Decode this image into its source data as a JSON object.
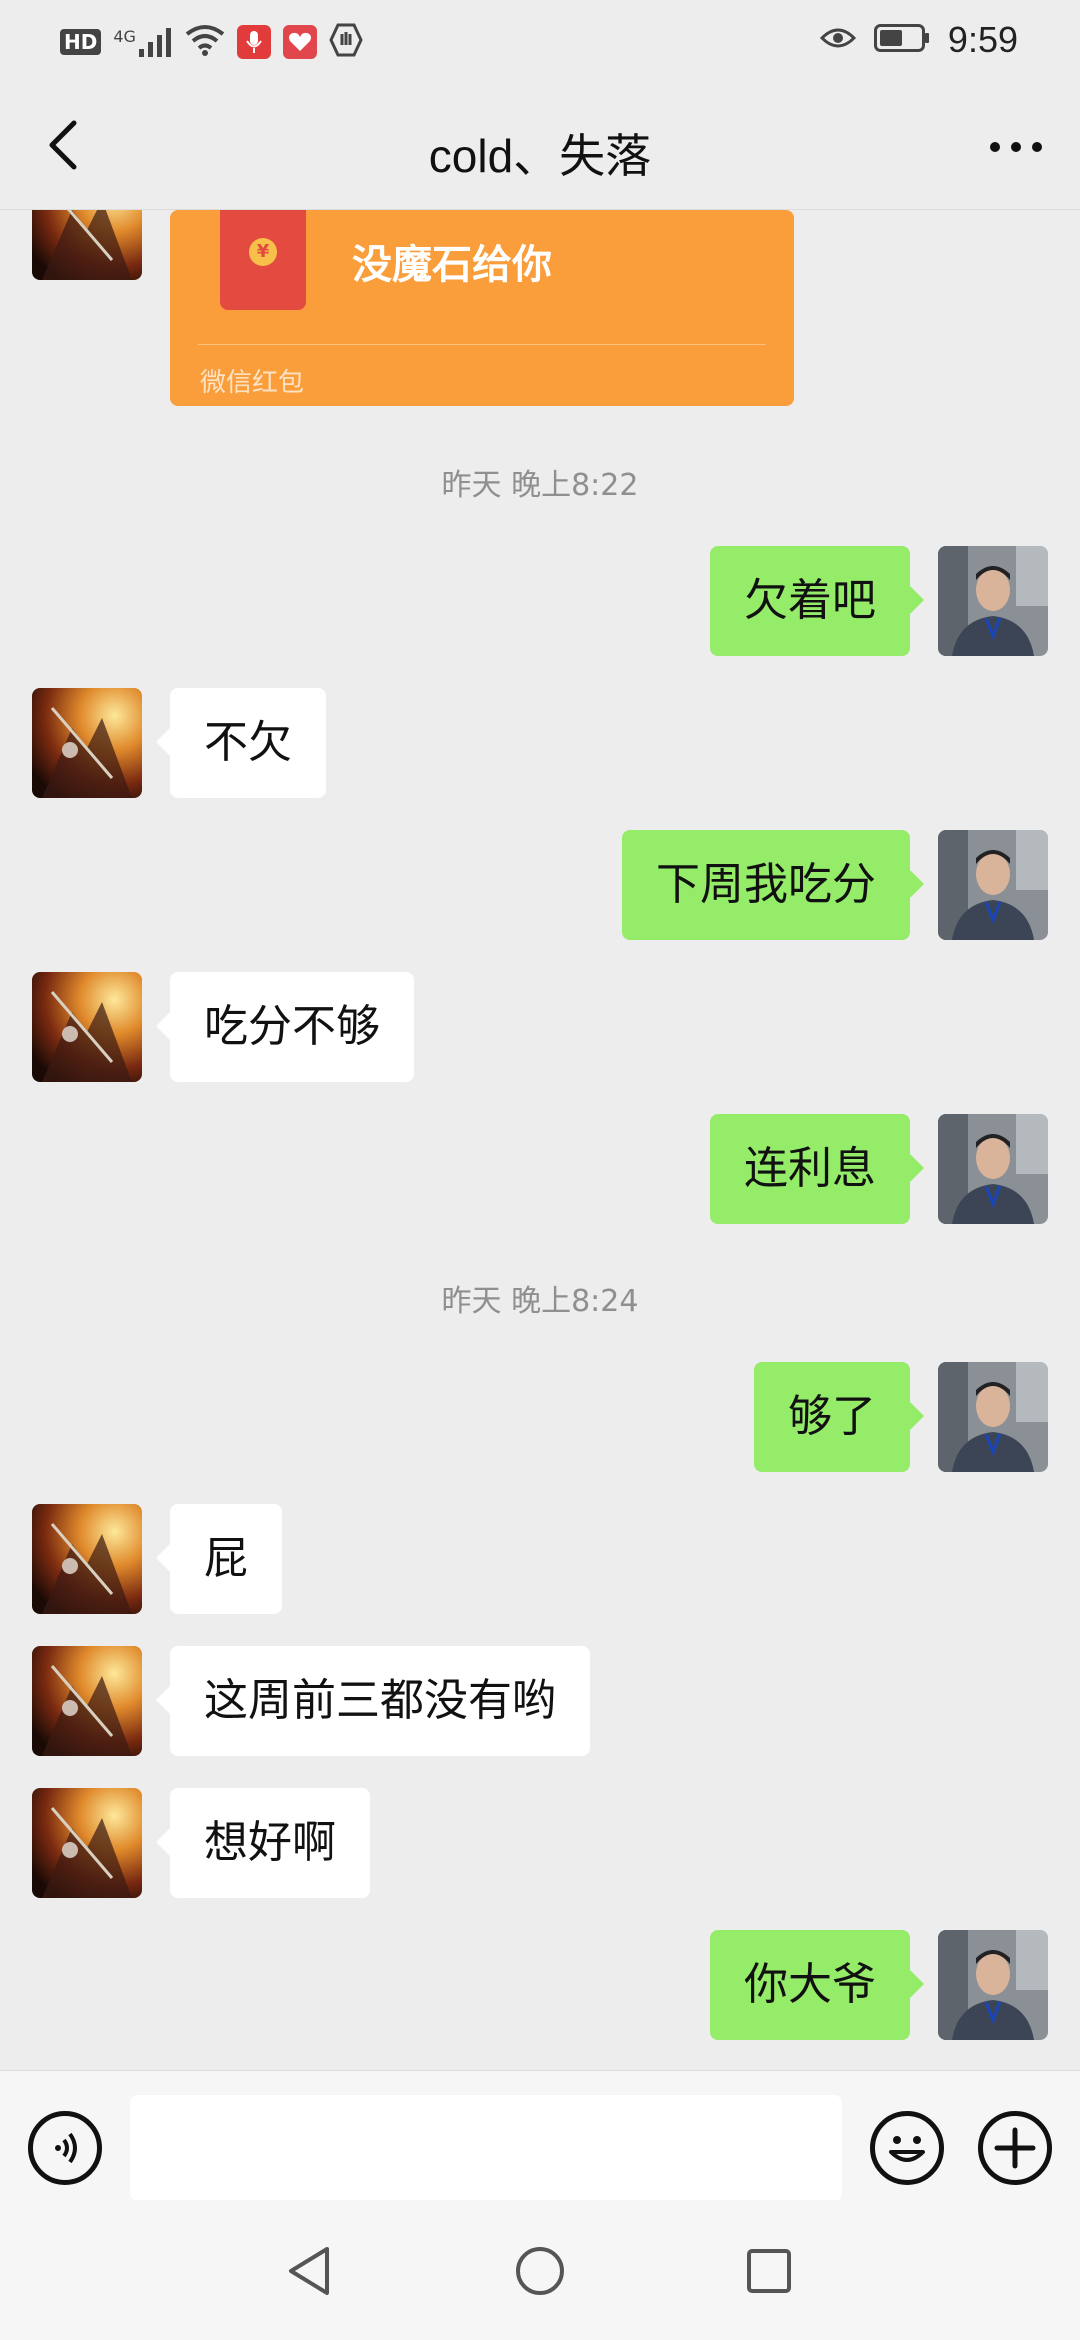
{
  "status_bar": {
    "hd_label": "HD",
    "network_label": "4G",
    "time": "9:59"
  },
  "header": {
    "title": "cold、失落",
    "back_icon": "chevron-left-icon",
    "more_icon": "more-dots-icon"
  },
  "red_packet": {
    "title": "没魔石给你",
    "footer": "微信红包",
    "coin_symbol": "¥"
  },
  "timestamps": [
    "昨天 晚上8:22",
    "昨天 晚上8:24"
  ],
  "messages": [
    {
      "side": "right",
      "text": "欠着吧"
    },
    {
      "side": "left",
      "text": "不欠"
    },
    {
      "side": "right",
      "text": "下周我吃分"
    },
    {
      "side": "left",
      "text": "吃分不够"
    },
    {
      "side": "right",
      "text": "连利息"
    },
    {
      "side": "right",
      "text": "够了"
    },
    {
      "side": "left",
      "text": "屁"
    },
    {
      "side": "left",
      "text": "这周前三都没有哟"
    },
    {
      "side": "left",
      "text": "想好啊"
    },
    {
      "side": "right",
      "text": "你大爷"
    }
  ],
  "input_bar": {
    "placeholder": "",
    "voice_icon": "voice-icon",
    "emoji_icon": "emoji-icon",
    "plus_icon": "plus-icon"
  },
  "colors": {
    "background": "#ededed",
    "bubble_right": "#95ec69",
    "bubble_left": "#ffffff",
    "red_packet": "#fa9d3b",
    "timestamp": "#8f8f8f"
  }
}
